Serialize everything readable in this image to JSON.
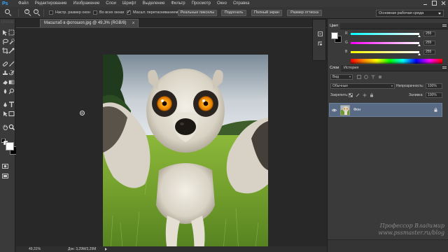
{
  "app": {
    "logo": "Ps",
    "menu": [
      "Файл",
      "Редактирование",
      "Изображение",
      "Слои",
      "Шрифт",
      "Выделение",
      "Фильтр",
      "Просмотр",
      "Окно",
      "Справка"
    ]
  },
  "options": {
    "resize_windows": "Настр. размер окон",
    "all_windows": "Во всех окнах",
    "scrubby_zoom": "Масшт. перетаскиванием",
    "btn_actual": "Реальные пикселы",
    "btn_fit": "Подогнать",
    "btn_fill": "Полный экран",
    "btn_print": "Размер оттиска",
    "workspace": "Основная рабочая среда"
  },
  "document": {
    "tab_title": "Масштаб в фотошоп.jpg @ 49,3% (RGB/8)",
    "close": "×"
  },
  "status": {
    "zoom": "49,31%",
    "doc": "Док: 3,29M/3,29M"
  },
  "color_panel": {
    "title": "Цвет",
    "sliders": [
      {
        "label": "R",
        "value": "255",
        "color_a": "#00ffff",
        "color_b": "#ffffff"
      },
      {
        "label": "G",
        "value": "255",
        "color_a": "#ff00ff",
        "color_b": "#ffffff"
      },
      {
        "label": "B",
        "value": "255",
        "color_a": "#ffff00",
        "color_b": "#ffffff"
      }
    ]
  },
  "layers_panel": {
    "tabs": [
      "Слои",
      "История"
    ],
    "kind": "Вид",
    "blend": "Обычные",
    "opacity_label": "Непрозрачность:",
    "opacity_value": "100%",
    "lock_label": "Закрепить:",
    "fill_label": "Заливка:",
    "fill_value": "100%",
    "layer_name": "Фон"
  },
  "watermark": {
    "line1": "Профессор Владимир",
    "line2": "www.pssmaster.ru/blog"
  },
  "colors": {
    "accent_layer": "#596a84",
    "ps_logo": "#31a8ff"
  }
}
